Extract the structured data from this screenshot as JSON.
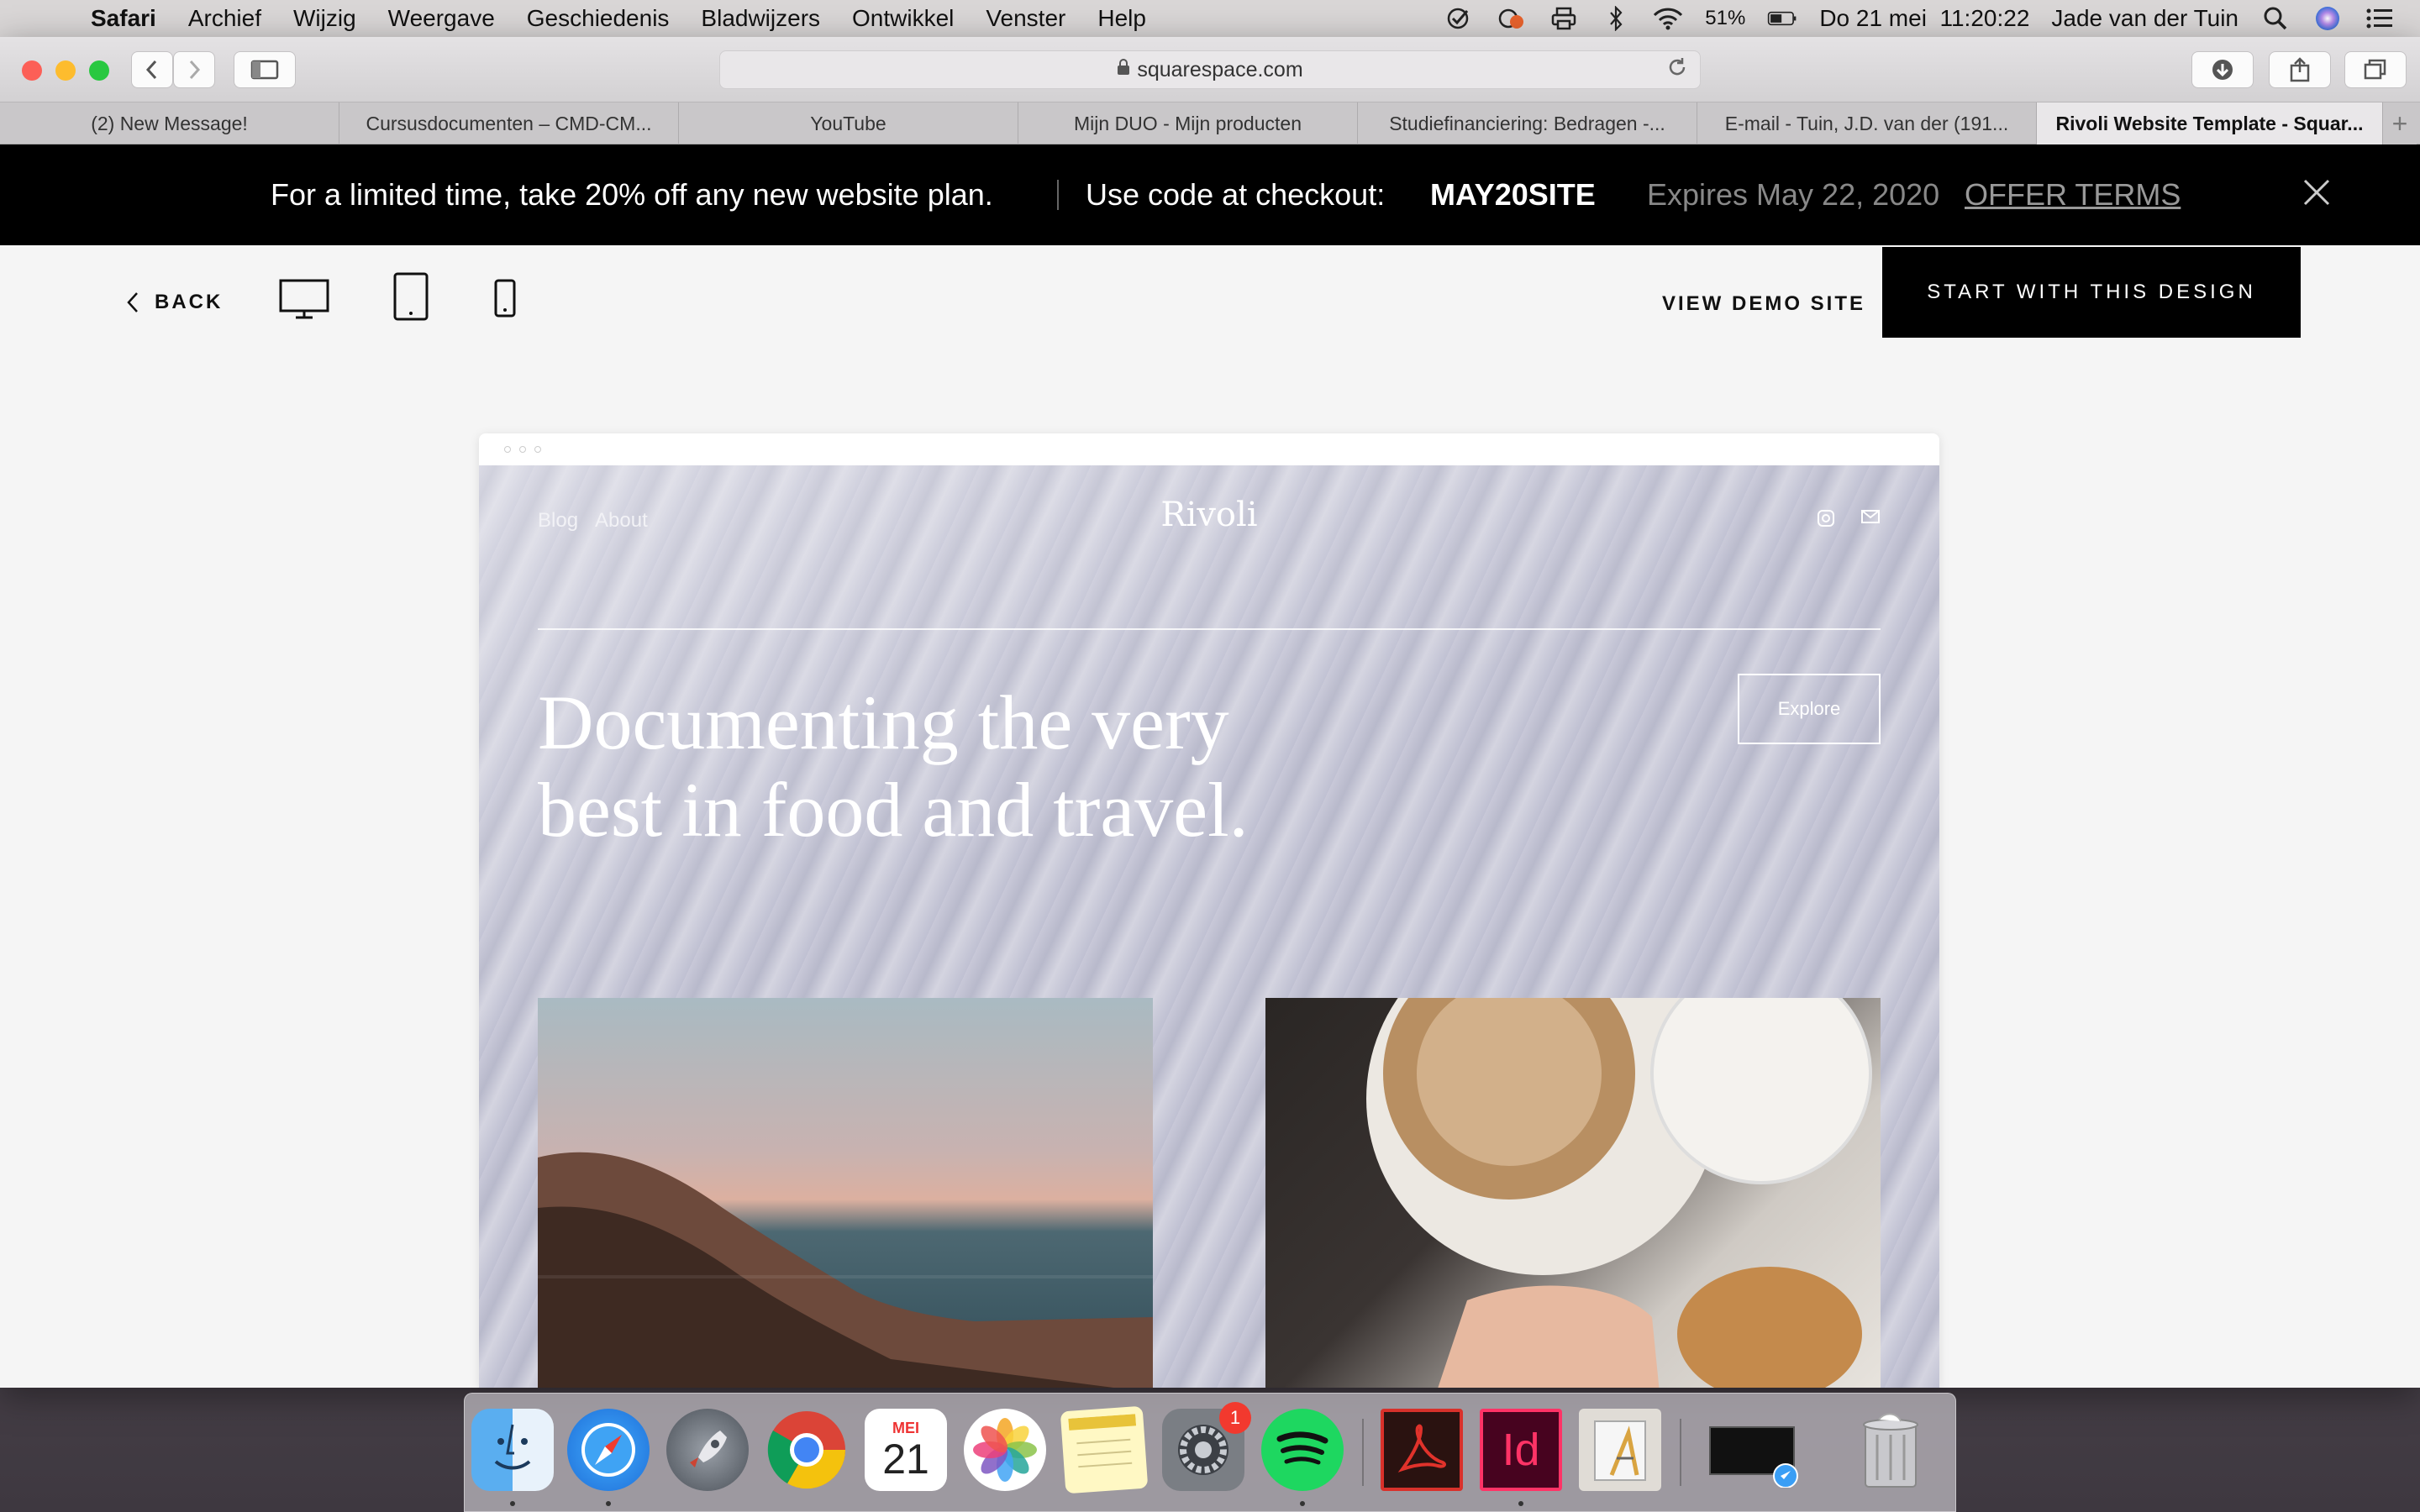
{
  "menubar": {
    "app": "Safari",
    "items": [
      "Archief",
      "Wijzig",
      "Weergave",
      "Geschiedenis",
      "Bladwijzers",
      "Ontwikkel",
      "Venster",
      "Help"
    ],
    "battery": "51%",
    "datetime": "Do 21 mei  11:20:22",
    "user": "Jade van der Tuin"
  },
  "browser": {
    "url": "squarespace.com",
    "tabs": [
      "(2) New Message!",
      "Cursusdocumenten – CMD-CM...",
      "YouTube",
      "Mijn DUO - Mijn producten",
      "Studiefinanciering: Bedragen -...",
      "E-mail - Tuin, J.D. van der (191...",
      "Rivoli Website Template - Squar..."
    ],
    "new_tab": "+"
  },
  "promo": {
    "offer": "For a limited time, take 20% off any new website plan.",
    "code_label": "Use code at checkout:",
    "code": "MAY20SITE",
    "expires": "Expires May 22, 2020",
    "terms": "OFFER TERMS"
  },
  "nav": {
    "back": "BACK",
    "view_demo": "VIEW DEMO SITE",
    "start": "START WITH THIS DESIGN"
  },
  "site": {
    "nav_links": [
      "Blog",
      "About"
    ],
    "logo": "Rivoli",
    "headline_line1": "Documenting the very",
    "headline_line2": "best in food and travel.",
    "explore": "Explore"
  },
  "dock": {
    "calendar_month": "MEI",
    "calendar_day": "21",
    "prefs_badge": "1",
    "indesign_label": "Id"
  }
}
